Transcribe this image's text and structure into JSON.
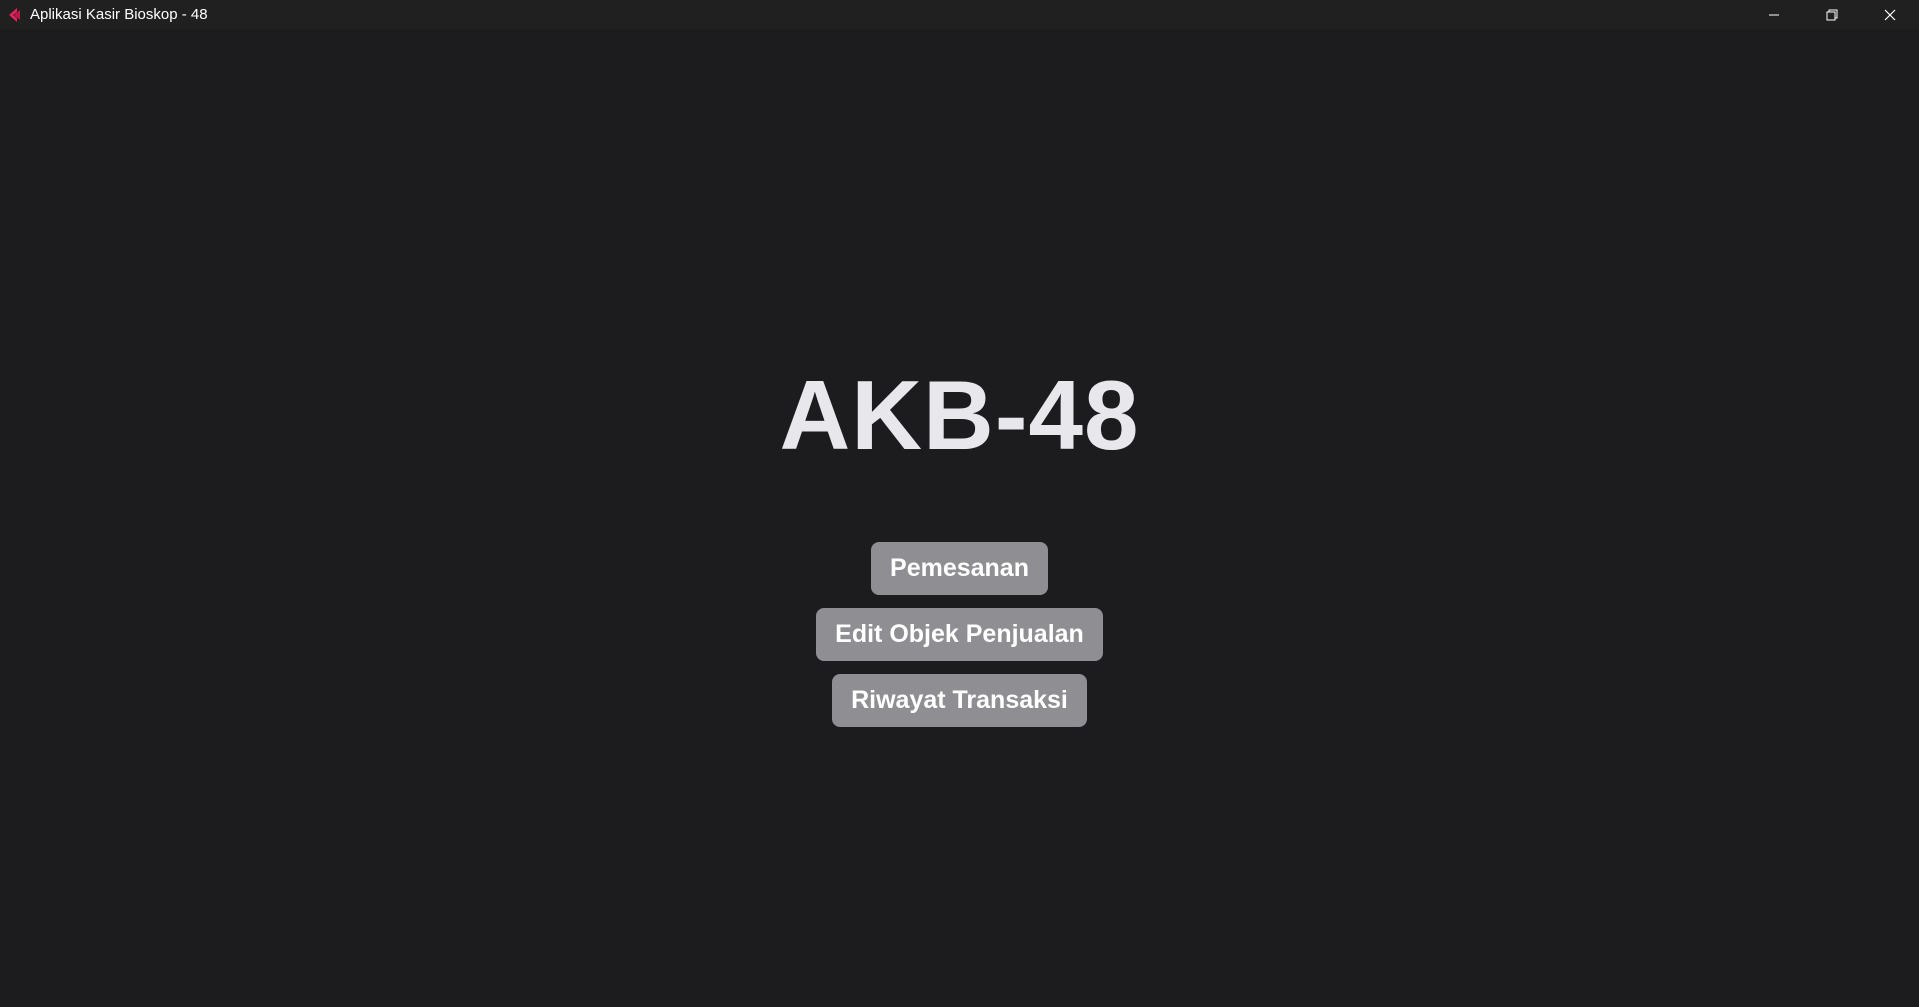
{
  "window": {
    "title": "Aplikasi Kasir Bioskop - 48",
    "icon": "app-icon",
    "controls": [
      "minimize-icon",
      "restore-icon",
      "close-icon"
    ]
  },
  "main": {
    "app_name": "AKB-48",
    "menu": [
      {
        "label": "Pemesanan"
      },
      {
        "label": "Edit Objek Penjualan"
      },
      {
        "label": "Riwayat Transaksi"
      }
    ]
  },
  "colors": {
    "background": "#1c1c1e",
    "titlebar": "#202020",
    "button": "#8f8f93",
    "heading_text": "#e8e8ec",
    "icon_accent": "#e0245e"
  }
}
